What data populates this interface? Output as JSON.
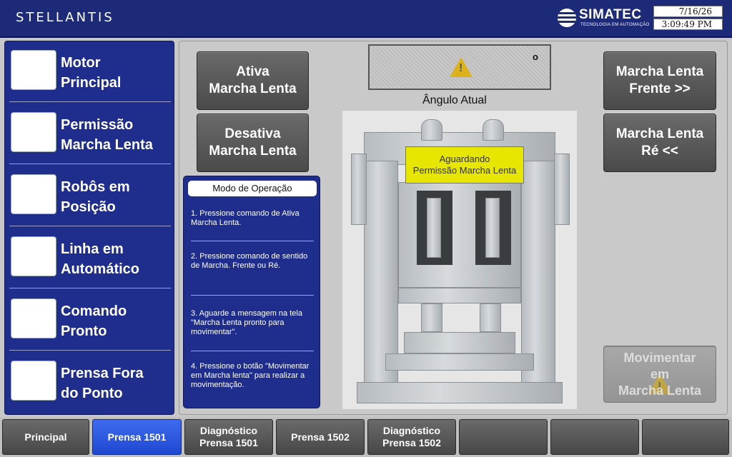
{
  "header": {
    "brand_left": "STELLANTIS",
    "brand_right": "SIMATEC",
    "brand_right_sub": "TECNOLOGIA EM AUTOMAÇÃO",
    "date": "7/16/26",
    "time": "3:09:49 PM"
  },
  "status_panel": {
    "items": [
      {
        "label": "Motor\nPrincipal"
      },
      {
        "label": "Permissão\nMarcha Lenta"
      },
      {
        "label": "Robôs em\nPosição"
      },
      {
        "label": "Linha em\nAutomático"
      },
      {
        "label": "Comando\nPronto"
      },
      {
        "label": "Prensa Fora\ndo Ponto"
      }
    ]
  },
  "controls": {
    "activate_label": "Ativa\nMarcha Lenta",
    "deactivate_label": "Desativa\nMarcha Lenta",
    "forward_label": "Marcha Lenta\nFrente >>",
    "reverse_label": "Marcha Lenta\nRé <<",
    "move_label": "Movimentar\nem\nMarcha Lenta"
  },
  "angle": {
    "value": "o",
    "label": "Ângulo Atual"
  },
  "press": {
    "status_message": "Aguardando\nPermissão Marcha Lenta"
  },
  "instructions": {
    "title": "Modo de Operação",
    "steps": [
      "1. Pressione comando de Ativa Marcha Lenta.",
      "2. Pressione comando de sentido de Marcha. Frente ou Ré.",
      "3. Aguarde a mensagem na tela \"Marcha Lenta pronto para movimentar\".",
      "4. Pressione o botão \"Movimentar em Marcha lenta\" para realizar a movimentação."
    ]
  },
  "nav": {
    "tabs": [
      {
        "label": "Principal"
      },
      {
        "label": "Prensa 1501"
      },
      {
        "label": "Diagnóstico\nPrensa 1501"
      },
      {
        "label": "Prensa 1502"
      },
      {
        "label": "Diagnóstico\nPrensa 1502"
      },
      {
        "label": ""
      },
      {
        "label": ""
      },
      {
        "label": ""
      }
    ],
    "active_index": 1
  },
  "colors": {
    "panel_blue": "#1f2e8c",
    "header_blue": "#1c2a78",
    "banner_yellow": "#e6e600",
    "active_tab_blue": "#2a56e0",
    "warning_amber": "#e0b000"
  }
}
